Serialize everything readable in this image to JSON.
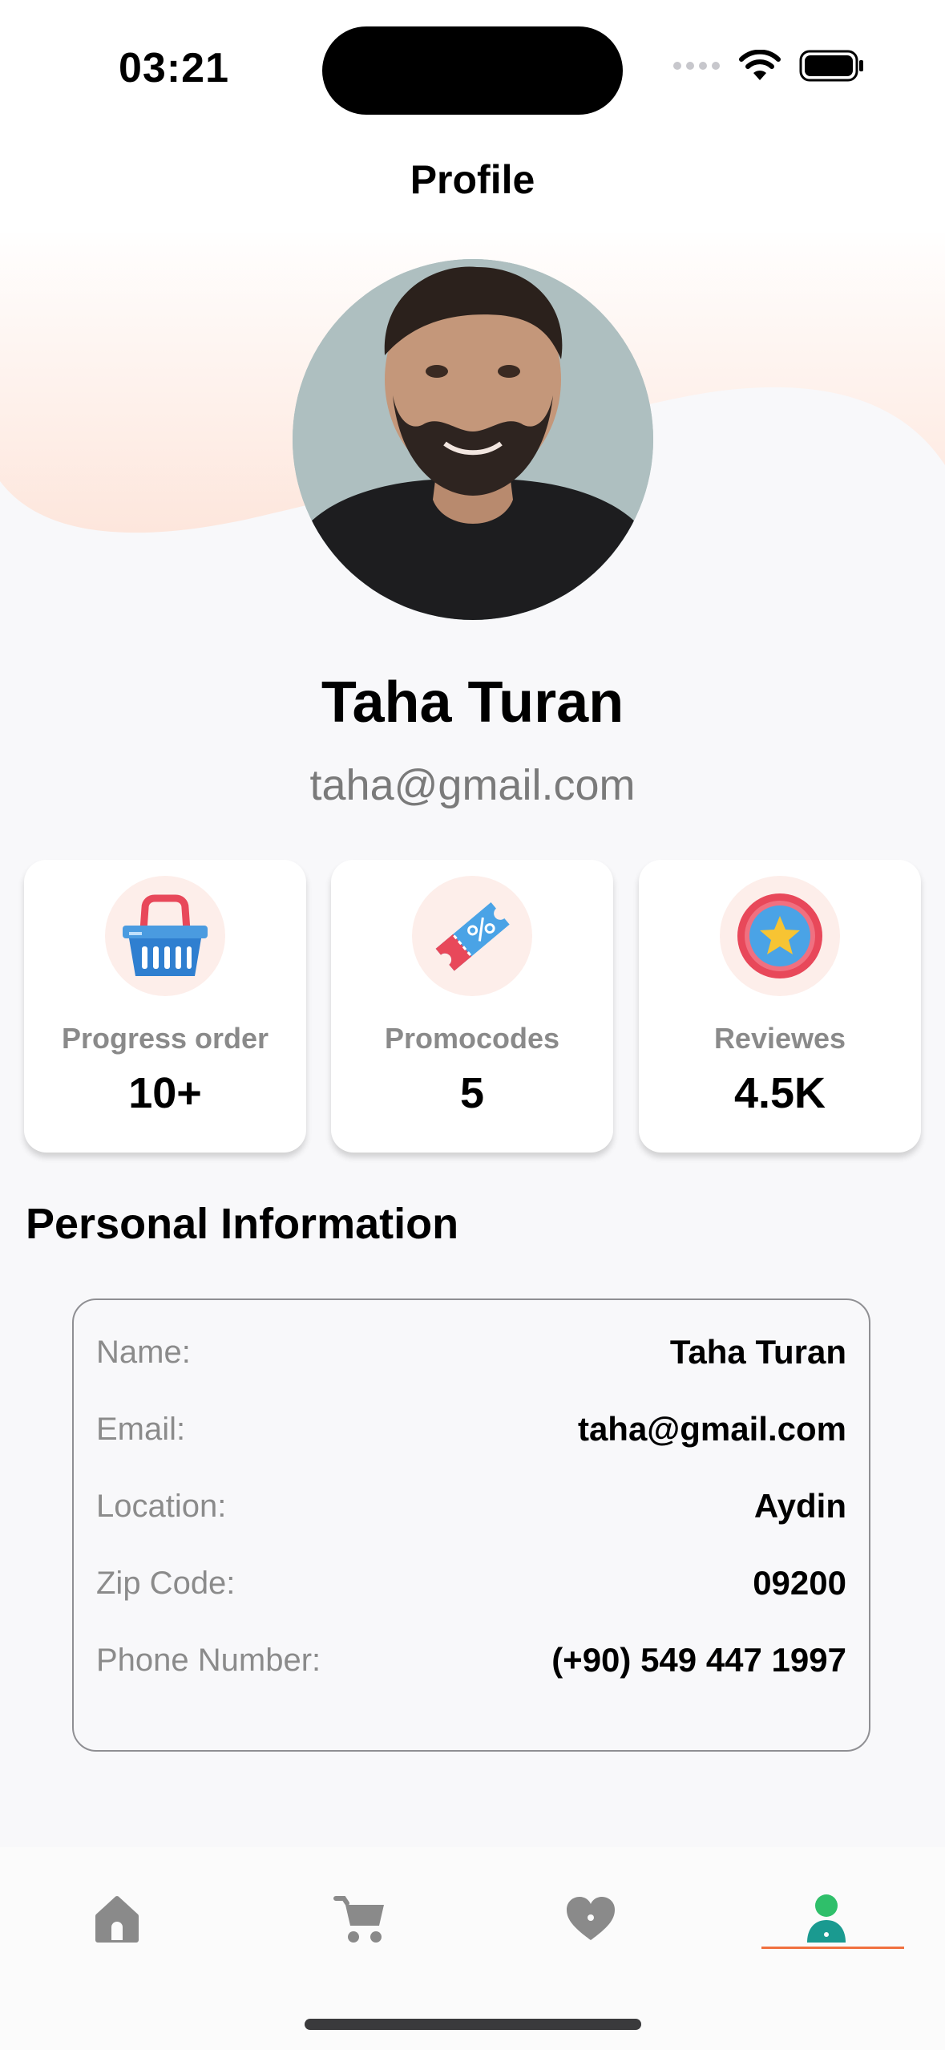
{
  "status_bar": {
    "time": "03:21"
  },
  "header": {
    "title": "Profile"
  },
  "profile": {
    "name": "Taha Turan",
    "email": "taha@gmail.com"
  },
  "stats": [
    {
      "label": "Progress order",
      "value": "10+",
      "icon": "basket-icon"
    },
    {
      "label": "Promocodes",
      "value": "5",
      "icon": "ticket-icon"
    },
    {
      "label": "Reviewes",
      "value": "4.5K",
      "icon": "star-badge-icon"
    }
  ],
  "personal_info": {
    "title": "Personal Information",
    "rows": [
      {
        "key": "Name:",
        "value": "Taha Turan"
      },
      {
        "key": "Email:",
        "value": "taha@gmail.com"
      },
      {
        "key": "Location:",
        "value": "Aydin"
      },
      {
        "key": "Zip Code:",
        "value": "09200"
      },
      {
        "key": "Phone Number:",
        "value": "(+90) 549 447 1997"
      }
    ]
  },
  "tabbar": {
    "items": [
      {
        "icon": "home-icon",
        "active": false
      },
      {
        "icon": "cart-icon",
        "active": false
      },
      {
        "icon": "heart-icon",
        "active": false
      },
      {
        "icon": "profile-icon",
        "active": true
      }
    ]
  },
  "colors": {
    "accent": "#f0703f",
    "background": "#f8f8fa",
    "active_tab": "#1a9a90",
    "inactive_tab": "#8a8a8a"
  }
}
